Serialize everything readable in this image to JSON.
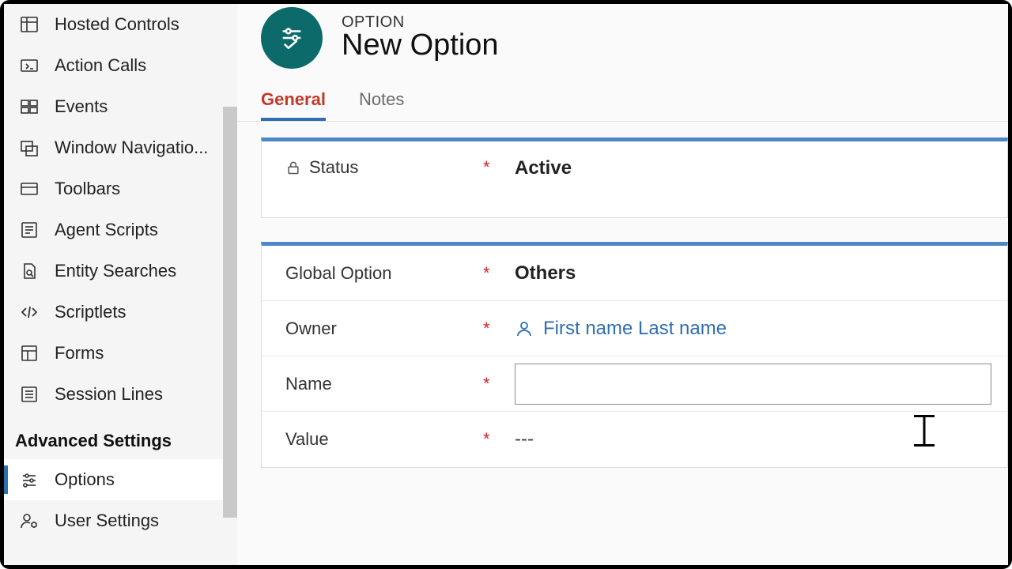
{
  "sidebar": {
    "items": [
      {
        "label": "Hosted Controls"
      },
      {
        "label": "Action Calls"
      },
      {
        "label": "Events"
      },
      {
        "label": "Window Navigatio..."
      },
      {
        "label": "Toolbars"
      },
      {
        "label": "Agent Scripts"
      },
      {
        "label": "Entity Searches"
      },
      {
        "label": "Scriptlets"
      },
      {
        "label": "Forms"
      },
      {
        "label": "Session Lines"
      }
    ],
    "section_title": "Advanced Settings",
    "advanced": [
      {
        "label": "Options"
      },
      {
        "label": "User Settings"
      }
    ]
  },
  "header": {
    "breadcrumb": "OPTION",
    "title": "New Option"
  },
  "tabs": [
    {
      "label": "General",
      "active": true
    },
    {
      "label": "Notes",
      "active": false
    }
  ],
  "form": {
    "status": {
      "label": "Status",
      "required": true,
      "locked": true,
      "value": "Active"
    },
    "global_option": {
      "label": "Global Option",
      "required": true,
      "value": "Others"
    },
    "owner": {
      "label": "Owner",
      "required": true,
      "value": "First name Last name"
    },
    "name": {
      "label": "Name",
      "required": true,
      "value": ""
    },
    "value": {
      "label": "Value",
      "required": true,
      "value": "---"
    }
  },
  "required_mark": "*"
}
